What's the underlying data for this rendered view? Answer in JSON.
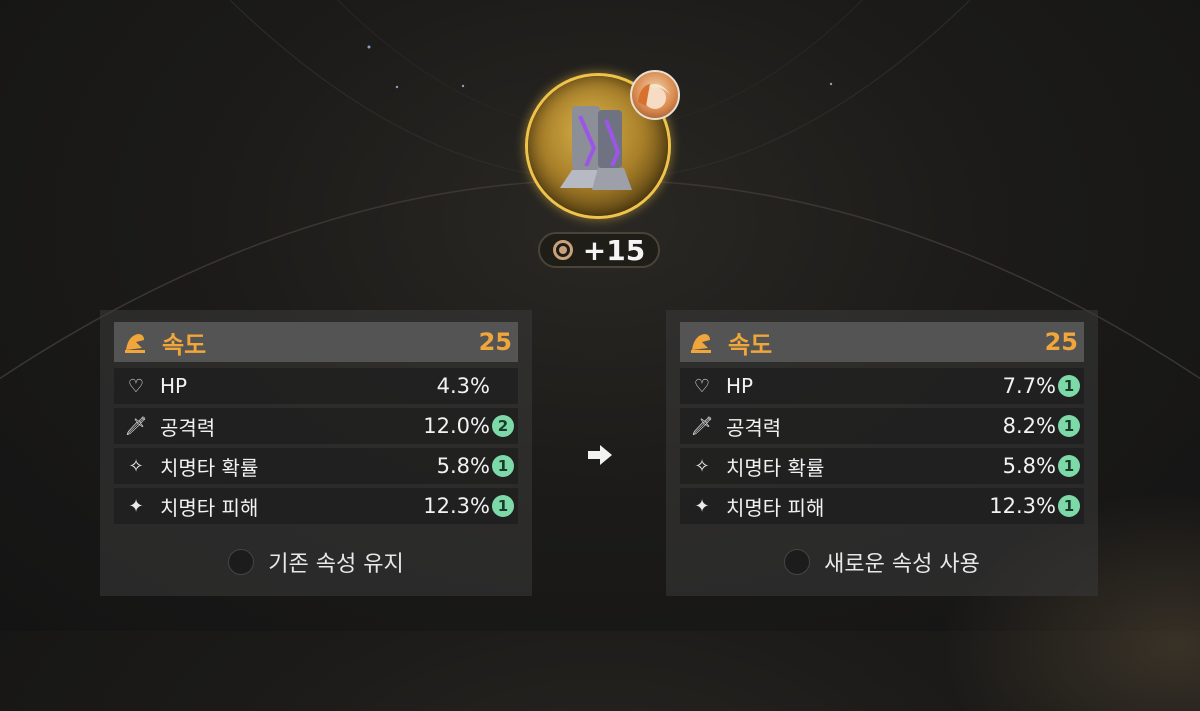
{
  "item": {
    "name": "boots",
    "enhance_level": "+15",
    "icon": "boots-item-icon",
    "avatar": "hero-portrait-icon"
  },
  "left_panel": {
    "main_stat": {
      "icon": "speed-icon",
      "label": "속도",
      "value": "25"
    },
    "substats": [
      {
        "icon": "heart-icon",
        "label": "HP",
        "value": "4.3%",
        "badge": ""
      },
      {
        "icon": "sword-icon",
        "label": "공격력",
        "value": "12.0%",
        "badge": "2"
      },
      {
        "icon": "crit-chance-icon",
        "label": "치명타 확률",
        "value": "5.8%",
        "badge": "1"
      },
      {
        "icon": "crit-damage-icon",
        "label": "치명타 피해",
        "value": "12.3%",
        "badge": "1"
      }
    ],
    "choice_label": "기존 속성 유지"
  },
  "right_panel": {
    "main_stat": {
      "icon": "speed-icon",
      "label": "속도",
      "value": "25"
    },
    "substats": [
      {
        "icon": "heart-icon",
        "label": "HP",
        "value": "7.7%",
        "badge": "1"
      },
      {
        "icon": "sword-icon",
        "label": "공격력",
        "value": "8.2%",
        "badge": "1"
      },
      {
        "icon": "crit-chance-icon",
        "label": "치명타 확률",
        "value": "5.8%",
        "badge": "1"
      },
      {
        "icon": "crit-damage-icon",
        "label": "치명타 피해",
        "value": "12.3%",
        "badge": "1"
      }
    ],
    "choice_label": "새로운 속성 사용"
  },
  "colors": {
    "accent": "#f0a63a",
    "badge": "#7ed9a8",
    "ring": "#f0c44a"
  }
}
